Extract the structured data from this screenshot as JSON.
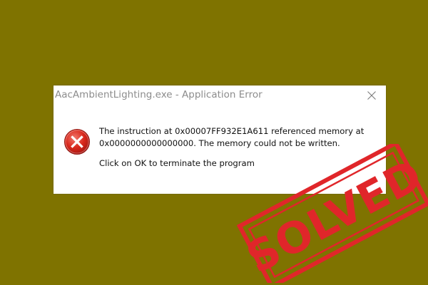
{
  "window": {
    "title": "AacAmbientLighting.exe - Application Error",
    "close_icon": "close-icon"
  },
  "dialog": {
    "icon": "error-icon",
    "message_line1": "The instruction at 0x00007FF932E1A611 referenced memory at",
    "message_line2": "0x0000000000000000. The memory could not be written.",
    "message_line3": "Click on OK to terminate the program"
  },
  "stamp": {
    "text": "SOLVED",
    "color": "#e0262a"
  },
  "colors": {
    "background": "#7f7300",
    "dialog_bg": "#ffffff",
    "title_text": "#8c8c8c",
    "error_red": "#d9281c"
  }
}
